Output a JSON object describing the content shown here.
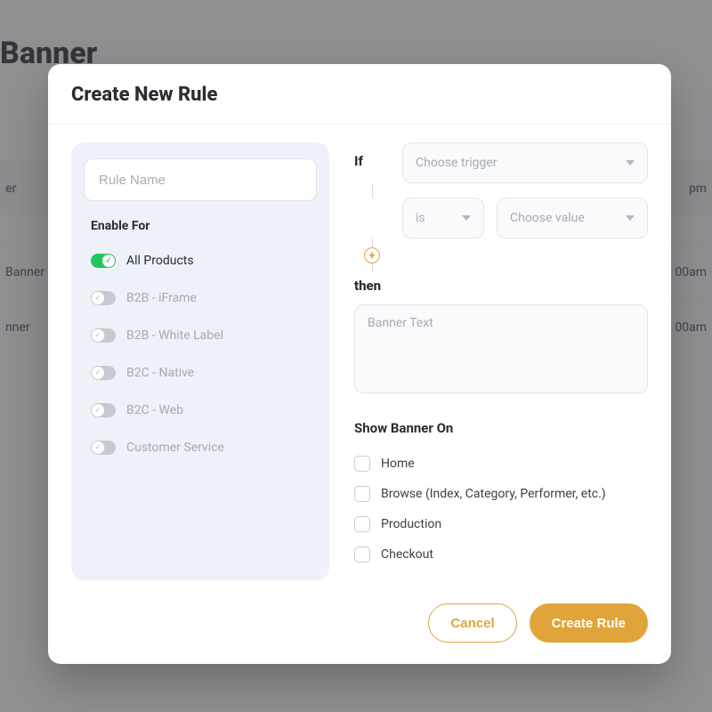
{
  "background": {
    "page_title": "Banner",
    "header_left": "er",
    "header_right": "pm",
    "rows": [
      {
        "left": "Banner",
        "right": "00am"
      },
      {
        "left": "nner",
        "right": "00am"
      }
    ]
  },
  "modal": {
    "title": "Create New Rule",
    "rule_name_placeholder": "Rule Name",
    "enable_for_label": "Enable For",
    "products": [
      {
        "label": "All Products",
        "on": true
      },
      {
        "label": "B2B - iFrame",
        "on": false
      },
      {
        "label": "B2B - White Label",
        "on": false
      },
      {
        "label": "B2C - Native",
        "on": false
      },
      {
        "label": "B2C - Web",
        "on": false
      },
      {
        "label": "Customer Service",
        "on": false
      }
    ],
    "if_label": "If",
    "then_label": "then",
    "trigger_placeholder": "Choose trigger",
    "operator_placeholder": "is",
    "value_placeholder": "Choose value",
    "banner_text_placeholder": "Banner Text",
    "show_on_label": "Show Banner On",
    "show_on_options": [
      "Home",
      "Browse (Index, Category, Performer, etc.)",
      "Production",
      "Checkout"
    ],
    "cancel_label": "Cancel",
    "submit_label": "Create Rule"
  }
}
